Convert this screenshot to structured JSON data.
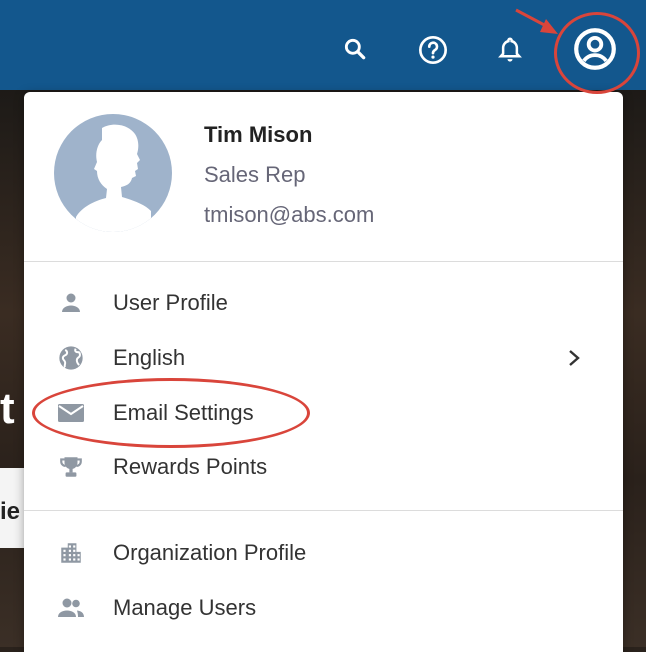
{
  "header": {
    "icons": [
      "search-icon",
      "help-icon",
      "bell-icon",
      "account-icon"
    ],
    "background_color": "#13578d"
  },
  "background": {
    "partial_text_1": "t",
    "partial_text_2": "ie"
  },
  "user": {
    "name": "Tim Mison",
    "role": "Sales Rep",
    "email": "tmison@abs.com"
  },
  "menu": {
    "items": [
      {
        "label": "User Profile",
        "icon": "person-icon"
      },
      {
        "label": "English",
        "icon": "globe-icon",
        "has_submenu": true
      },
      {
        "label": "Email Settings",
        "icon": "envelope-icon"
      },
      {
        "label": "Rewards Points",
        "icon": "trophy-icon"
      },
      {
        "label": "Organization Profile",
        "icon": "building-icon"
      },
      {
        "label": "Manage Users",
        "icon": "users-icon"
      }
    ]
  },
  "annotations": {
    "color": "#d9453b",
    "highlights": [
      "account-icon",
      "Email Settings"
    ]
  }
}
